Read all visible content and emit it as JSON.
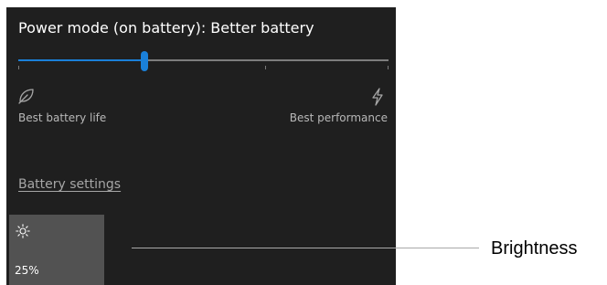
{
  "power_mode": {
    "title": "Power mode (on battery): Better battery",
    "slider_level_percent": 34,
    "left_label": "Best battery life",
    "right_label": "Best performance",
    "left_icon": "leaf-icon",
    "right_icon": "lightning-bolt-icon"
  },
  "battery_settings_link": "Battery settings",
  "brightness_tile": {
    "icon": "sun-icon",
    "value": "25%"
  },
  "callout": {
    "label": "Brightness"
  },
  "colors": {
    "panel_background": "#1f1f1f",
    "accent": "#1a80d9",
    "tile_background": "#525252",
    "secondary_text": "#b8b8b8"
  }
}
